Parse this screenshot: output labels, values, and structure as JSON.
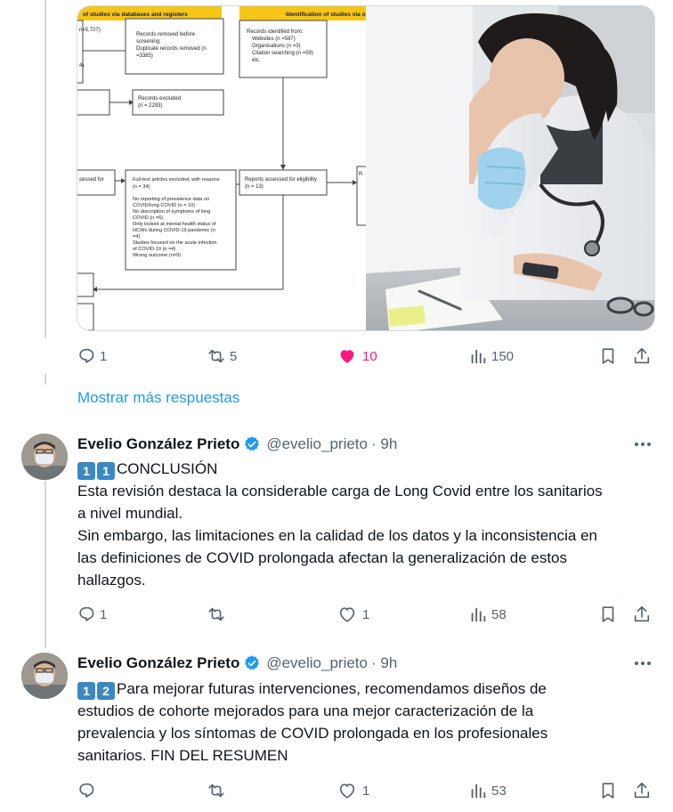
{
  "first_tweet_actions": {
    "replies": "1",
    "reposts": "5",
    "likes": "10",
    "views": "150"
  },
  "show_more_label": "Mostrar más respuestas",
  "media": {
    "flowchart_headers": [
      "of studies via databases and registers",
      "Identification of studies via ot"
    ],
    "flowchart_boxes": {
      "records_removed": [
        "Records removed before",
        "screening:",
        "Duplicate records removed (n",
        "=3385)"
      ],
      "identified_from": [
        "Records identified from:",
        "Websites (n =587)",
        "Organisations (n =3)",
        "Citation searching (n =59)",
        "etc."
      ],
      "records_excluded": [
        "Records excluded",
        "(n = 2293)"
      ],
      "fulltext_excluded": [
        "Full-text articles excluded, with reasons",
        "(n = 34)",
        "",
        "No reporting of prevalence data on",
        "COVID/long COVID (n = 10)",
        "No description of symptoms of long",
        "COVID (n =6)",
        "Only looked at mental health status of",
        "HCWs during COVID-19 pandemic (n",
        "=4)",
        "Studies focused on the acute infection",
        "of COVID-19 (n =4)",
        "Wrong outcome (n=9)"
      ],
      "reports_assessed": [
        "Reports assessed for eligibility",
        "(n = 13)"
      ],
      "left_fragments": [
        "n=5,727)",
        "4)",
        "sessed for"
      ],
      "right_fragment": "R"
    },
    "colors": {
      "header_yellow": "#f5c518"
    }
  },
  "posts": [
    {
      "author": "Evelio González Prieto",
      "handle": "@evelio_prieto",
      "time": "· 9h",
      "keycaps": [
        "1",
        "1"
      ],
      "lines": [
        "CONCLUSIÓN",
        "Esta revisión destaca la considerable carga de Long Covid entre los sanitarios",
        "a nivel mundial.",
        "Sin embargo, las limitaciones en la calidad de los datos y la inconsistencia en",
        "las definiciones de COVID prolongada afectan la generalización de estos",
        "hallazgos."
      ],
      "actions": {
        "replies": "1",
        "reposts": "",
        "likes": "1",
        "views": "58"
      }
    },
    {
      "author": "Evelio González Prieto",
      "handle": "@evelio_prieto",
      "time": "· 9h",
      "keycaps": [
        "1",
        "2"
      ],
      "lines": [
        "Para mejorar futuras intervenciones, recomendamos diseños de",
        "estudios de cohorte mejorados para una mejor caracterización de la",
        "prevalencia y los síntomas de COVID prolongada en los profesionales",
        "sanitarios. FIN DEL RESUMEN"
      ],
      "actions": {
        "replies": "",
        "reposts": "",
        "likes": "1",
        "views": "53"
      }
    }
  ],
  "icons": [
    "reply-icon",
    "repost-icon",
    "like-icon",
    "views-icon",
    "bookmark-icon",
    "share-icon",
    "verified-badge-icon",
    "more-options-icon"
  ],
  "colors": {
    "accent": "#1d9bf0",
    "like_active": "#f91880",
    "muted": "#536471",
    "text": "#0f1419",
    "keycap": "#3b88c3"
  }
}
